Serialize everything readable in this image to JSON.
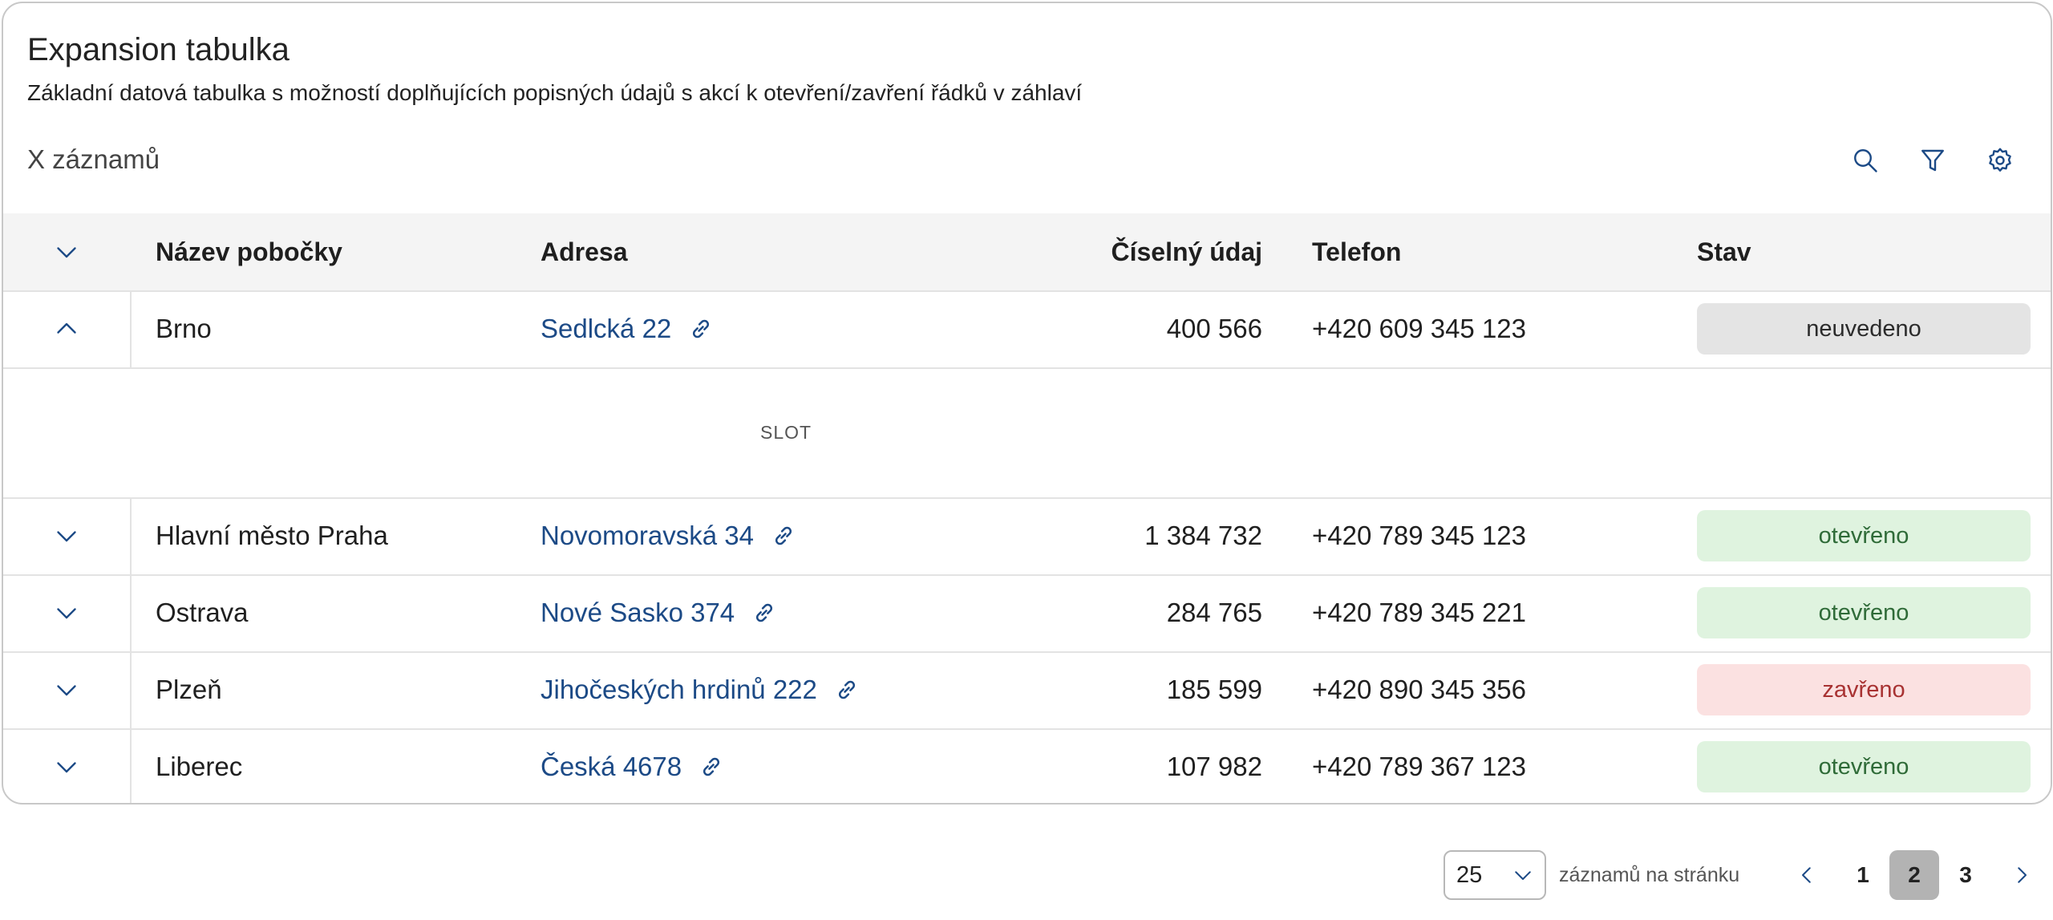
{
  "header": {
    "title": "Expansion tabulka",
    "subtitle": "Základní datová tabulka s možností doplňujících popisných údajů s akcí k otevření/zavření řádků v záhlaví",
    "record_count": "X záznamů"
  },
  "toolbar": {
    "icons": [
      "search-icon",
      "filter-icon",
      "settings-icon"
    ]
  },
  "table": {
    "columns": [
      "Název pobočky",
      "Adresa",
      "Číselný údaj",
      "Telefon",
      "Stav"
    ],
    "rows": [
      {
        "name": "Brno",
        "address": "Sedlcká 22",
        "number": "400 566",
        "phone": "+420 609 345 123",
        "status": "neuvedeno",
        "status_color": "#e4e4e4",
        "expanded": true
      },
      {
        "name": "Hlavní město Praha",
        "address": "Novomoravská 34",
        "number": "1 384 732",
        "phone": "+420 789 345 123",
        "status": "otevřeno",
        "status_color": "#dff3df",
        "expanded": false
      },
      {
        "name": "Ostrava",
        "address": "Nové Sasko 374",
        "number": "284 765",
        "phone": "+420 789 345 221",
        "status": "otevřeno",
        "status_color": "#dff3df",
        "expanded": false
      },
      {
        "name": "Plzeň",
        "address": "Jihočeských hrdinů 222",
        "number": "185 599",
        "phone": "+420 890 345 356",
        "status": "zavřeno",
        "status_color": "#fbe1e1",
        "expanded": false
      },
      {
        "name": "Liberec",
        "address": "Česká 4678",
        "number": "107 982",
        "phone": "+420 789 367 123",
        "status": "otevřeno",
        "status_color": "#dff3df",
        "expanded": false
      }
    ],
    "slot_label": "SLOT"
  },
  "pagination": {
    "page_size": "25",
    "per_page_label": "záznamů na stránku",
    "pages": [
      "1",
      "2",
      "3"
    ],
    "current_page": "2"
  },
  "colors": {
    "link": "#1c4a86",
    "header_bg": "#f4f4f4",
    "active_page_bg": "#b3b3b3"
  }
}
